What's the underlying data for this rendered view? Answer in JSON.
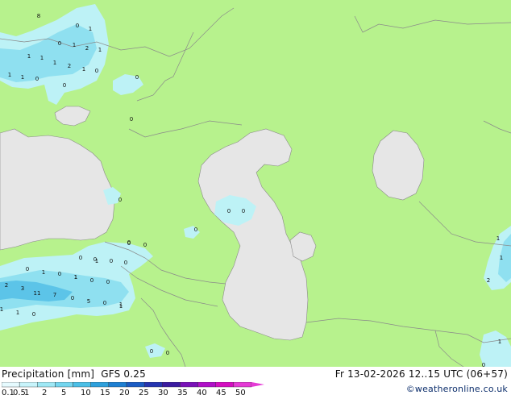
{
  "title": "Precipitation [mm]",
  "model": "GFS 0.25",
  "valid_time": "Fr 13-02-2026 12..15 UTC (06+57)",
  "copyright": "©weatheronline.co.uk",
  "colors": {
    "land": "#b7f28d",
    "water": "#e6e6e6",
    "border": "#8a8a8a",
    "precip_light": "#bdf2f6",
    "precip_mid": "#8fe0f0",
    "precip_heavy": "#5cc4e8"
  },
  "legend": {
    "ticks": [
      "0.1",
      "0.5",
      "1",
      "2",
      "5",
      "10",
      "15",
      "20",
      "25",
      "30",
      "35",
      "40",
      "45",
      "50"
    ],
    "colors": [
      "#e6fbff",
      "#c8f4fb",
      "#9fe8f5",
      "#74d6ef",
      "#4cbfe6",
      "#2ea0dc",
      "#1e7fd2",
      "#1b5cc4",
      "#2535b0",
      "#3b1ba0",
      "#7a12b8",
      "#b010c8",
      "#d40ec0",
      "#e53bd6"
    ]
  },
  "precip_labels": [
    {
      "text": "8"
    },
    {
      "text": "0"
    },
    {
      "text": "1"
    },
    {
      "text": "0"
    },
    {
      "text": "1"
    },
    {
      "text": "2"
    },
    {
      "text": "1"
    },
    {
      "text": "1"
    },
    {
      "text": "1"
    },
    {
      "text": "1"
    },
    {
      "text": "2"
    },
    {
      "text": "1"
    },
    {
      "text": "0"
    },
    {
      "text": "1"
    },
    {
      "text": "1"
    },
    {
      "text": "0"
    },
    {
      "text": "0"
    },
    {
      "text": "0"
    },
    {
      "text": "0"
    },
    {
      "text": "0"
    },
    {
      "text": "0"
    },
    {
      "text": "0"
    },
    {
      "text": "0"
    },
    {
      "text": "0"
    },
    {
      "text": "0"
    },
    {
      "text": "1"
    },
    {
      "text": "0"
    },
    {
      "text": "1"
    },
    {
      "text": "0"
    },
    {
      "text": "0"
    },
    {
      "text": "0"
    },
    {
      "text": "0"
    },
    {
      "text": "0"
    },
    {
      "text": "0"
    },
    {
      "text": "1"
    },
    {
      "text": "0"
    },
    {
      "text": "1"
    },
    {
      "text": "1"
    },
    {
      "text": "0"
    },
    {
      "text": "2"
    },
    {
      "text": "3"
    },
    {
      "text": "11"
    },
    {
      "text": "7"
    },
    {
      "text": "0"
    },
    {
      "text": "5"
    },
    {
      "text": "0"
    },
    {
      "text": "1"
    },
    {
      "text": "1"
    },
    {
      "text": "1"
    },
    {
      "text": "0"
    },
    {
      "text": "0"
    },
    {
      "text": "0"
    },
    {
      "text": "1"
    },
    {
      "text": "1"
    },
    {
      "text": "2"
    },
    {
      "text": "1"
    },
    {
      "text": "0"
    }
  ]
}
